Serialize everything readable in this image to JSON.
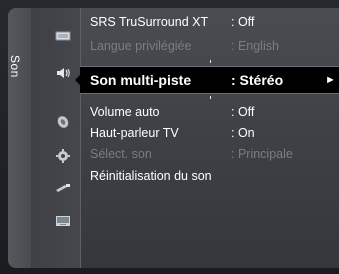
{
  "tab": {
    "label": "Son"
  },
  "icons": [
    "picture-icon",
    "sound-icon",
    "channel-icon",
    "setup-icon",
    "input-icon",
    "application-icon"
  ],
  "menu": {
    "items": [
      {
        "label": "SRS TruSurround XT",
        "value": ": Off",
        "enabled": true
      },
      {
        "label": "Langue privilégiée",
        "value": ": English",
        "enabled": false
      },
      {
        "label": "Son multi-piste",
        "value": ": Stéréo",
        "selected": true
      },
      {
        "label": "Volume auto",
        "value": ": Off",
        "enabled": true
      },
      {
        "label": "Haut-parleur TV",
        "value": ": On",
        "enabled": true
      },
      {
        "label": "Sélect. son",
        "value": ": Principale",
        "enabled": false
      },
      {
        "label": "Réinitialisation du son",
        "value": "",
        "enabled": true
      }
    ],
    "arrow": "►"
  }
}
